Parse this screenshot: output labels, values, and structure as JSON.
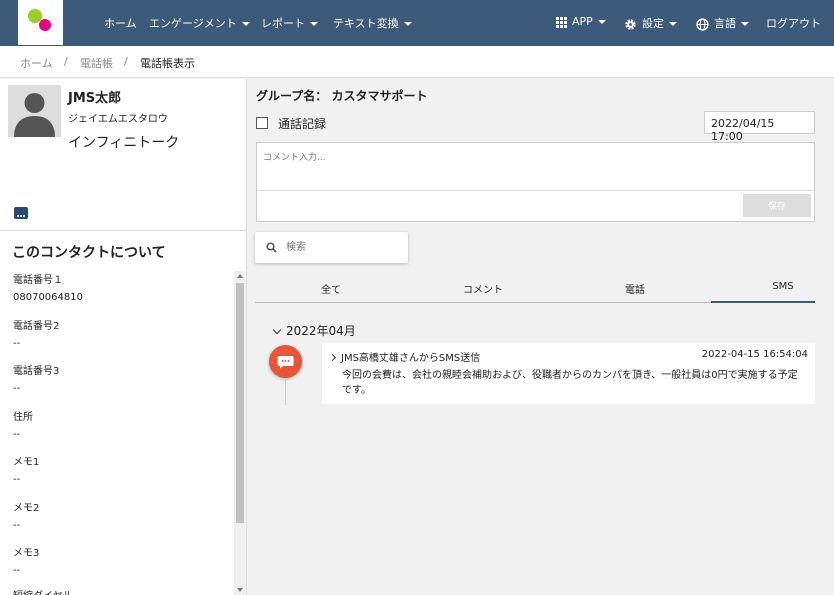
{
  "nav": {
    "items": [
      "ホーム",
      "エンゲージメント",
      "レポート",
      "テキスト変換"
    ],
    "app_label": "APP",
    "settings_label": "設定",
    "language_label": "言語",
    "logout_label": "ログアウト",
    "bar_color": "#3d5a7a"
  },
  "breadcrumb": [
    "ホーム",
    "電話帳",
    "電話帳表示"
  ],
  "contact": {
    "name": "JMS太郎",
    "kana": "ジェイエムエスタロウ",
    "company": "インフィニトーク",
    "about_title": "このコンタクトについて",
    "fields": [
      {
        "label": "電話番号１",
        "value": "08070064810"
      },
      {
        "label": "電話番号2",
        "value": "--"
      },
      {
        "label": "電話番号3",
        "value": "--"
      },
      {
        "label": "住所",
        "value": "--"
      },
      {
        "label": "メモ1",
        "value": "--"
      },
      {
        "label": "メモ2",
        "value": "--"
      },
      {
        "label": "メモ3",
        "value": "--"
      },
      {
        "label": "短縮ダイヤル",
        "value": ""
      }
    ]
  },
  "main": {
    "group_label": "グループ名： カスタマサポート",
    "call_record_label": "通話記録",
    "datetime": "2022/04/15 17:00",
    "comment_placeholder": "コメント入力...",
    "save_label": "保存",
    "search_placeholder": "検索",
    "tabs": [
      "全て",
      "コメント",
      "電話",
      "SMS"
    ],
    "active_tab": "SMS",
    "month": "2022年04月",
    "event": {
      "title": "JMS高橋丈雄さんからSMS送信",
      "time": "2022-04-15 16:54:04",
      "body": "今回の会費は、会社の親睦会補助および、役職者からのカンパを頂き、一般社員は0円で実施する予定です。",
      "icon": "sms-bubble-icon",
      "color": "#e8553a"
    }
  }
}
